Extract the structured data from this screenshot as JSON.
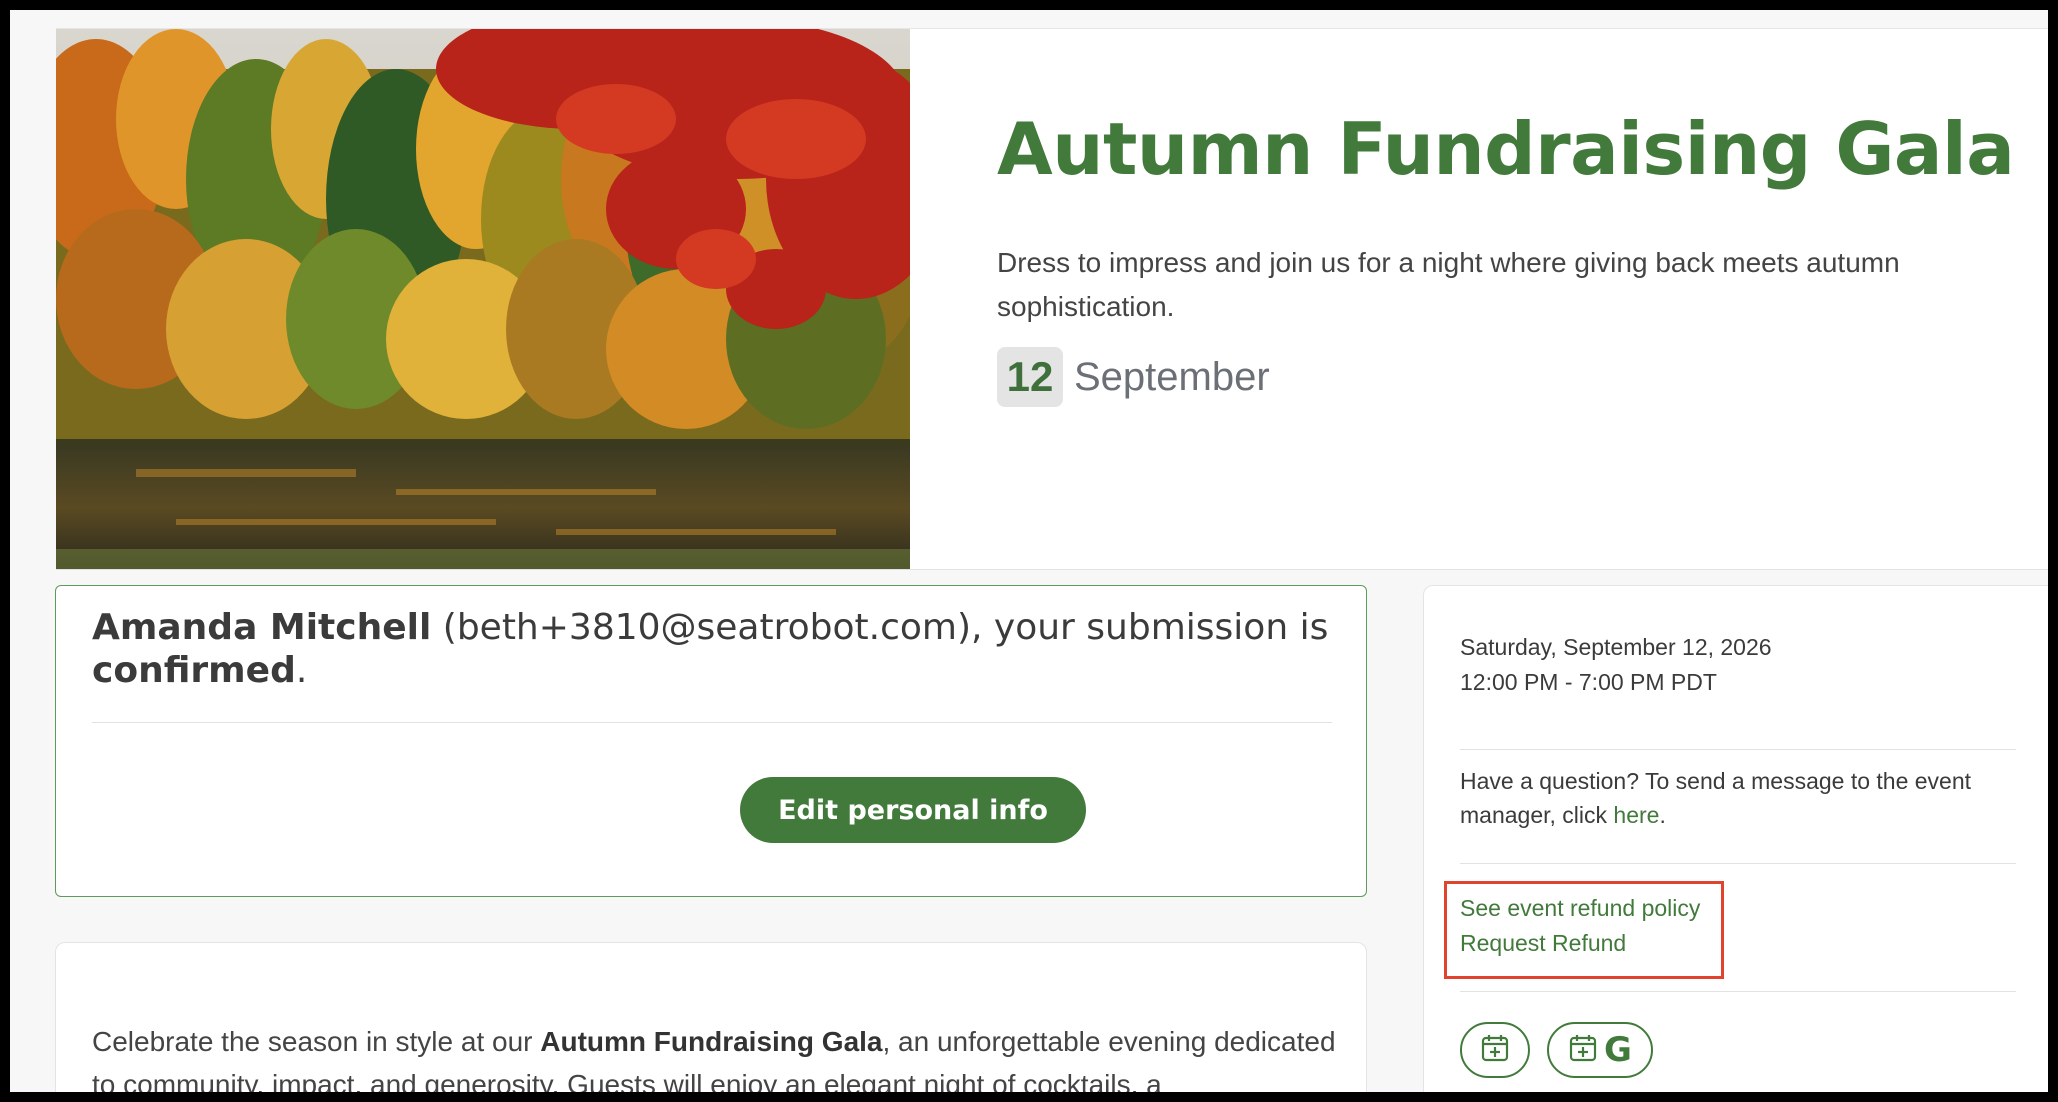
{
  "event": {
    "title": "Autumn Fundraising Gala",
    "description": "Dress to impress and join us for a night where giving back meets autumn sophistication.",
    "day": "12",
    "month": "September"
  },
  "confirmation": {
    "name": "Amanda Mitchell",
    "email_text": " (beth+3810@seatrobot.com), your submission is ",
    "status": "confirmed",
    "period": ".",
    "edit_button": "Edit personal info"
  },
  "details": {
    "intro": "Celebrate the season in style at our ",
    "event_name_bold": "Autumn Fundraising Gala",
    "rest": ", an unforgettable evening dedicated to community, impact, and generosity. Guests will enjoy an elegant night of cocktails, a"
  },
  "sidebar": {
    "date_line": "Saturday, September 12, 2026",
    "time_line": "12:00 PM - 7:00 PM PDT",
    "question_text": "Have a question? To send a message to the event manager, click ",
    "here_link": "here",
    "question_end": ".",
    "refund_policy_link": "See event refund policy",
    "request_refund_link": "Request Refund"
  },
  "colors": {
    "brand_green": "#427a3c",
    "highlight_red": "#e0432e"
  },
  "icons": {
    "calendar_add": "calendar-add-icon",
    "google_calendar": "google-calendar-icon"
  }
}
